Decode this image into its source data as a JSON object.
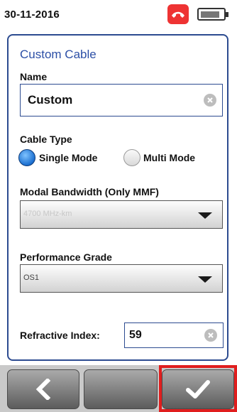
{
  "status_bar": {
    "date": "30-11-2016",
    "phone_icon": "phone-hangup-icon",
    "battery_icon": "battery-icon"
  },
  "panel": {
    "title": "Custom Cable",
    "name": {
      "label": "Name",
      "value": "Custom"
    },
    "cable_type": {
      "label": "Cable Type",
      "options": [
        {
          "label": "Single Mode",
          "selected": true
        },
        {
          "label": "Multi Mode",
          "selected": false
        }
      ]
    },
    "modal_bandwidth": {
      "label": "Modal Bandwidth (Only MMF)",
      "value": "4700 MHz-km",
      "enabled": false
    },
    "performance_grade": {
      "label": "Performance Grade",
      "value": "OS1"
    },
    "refractive_index": {
      "label": "Refractive Index:",
      "value": "59"
    }
  },
  "bottom_bar": {
    "back_icon": "chevron-left-icon",
    "confirm_icon": "checkmark-icon"
  },
  "colors": {
    "accent": "#2c4b90",
    "phone": "#ee3333",
    "highlight": "#e01e1e"
  }
}
